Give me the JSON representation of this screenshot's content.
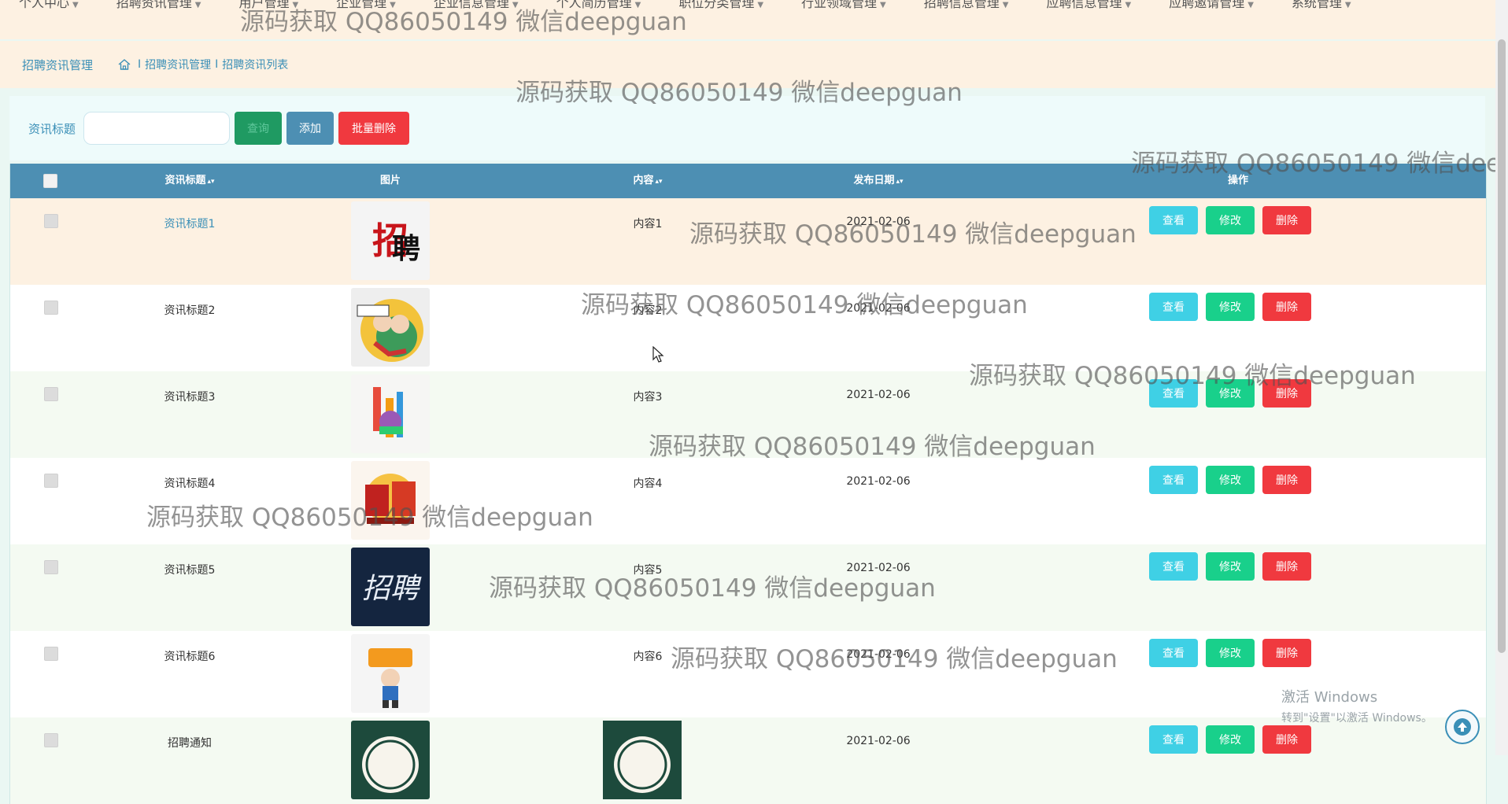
{
  "nav": {
    "items": [
      "个人中心",
      "招聘资讯管理",
      "用户管理",
      "企业管理",
      "企业信息管理",
      "个人简历管理",
      "职位分类管理",
      "行业领域管理",
      "招聘信息管理",
      "应聘信息管理",
      "应聘邀请管理",
      "系统管理"
    ]
  },
  "breadcrumb": {
    "title": "招聘资讯管理",
    "sep": "I",
    "items": [
      "招聘资讯管理",
      "招聘资讯列表"
    ]
  },
  "search": {
    "label": "资讯标题",
    "value": "",
    "placeholder": "",
    "search_label": "查询",
    "add_label": "添加",
    "batch_delete_label": "批量删除"
  },
  "table": {
    "columns": [
      "资讯标题",
      "图片",
      "内容",
      "发布日期",
      "操作"
    ],
    "sortable_marker": "▴▾",
    "rows": [
      {
        "title": "资讯标题1",
        "content": "内容1",
        "date": "2021-02-06",
        "image": "zhaopin-red-black"
      },
      {
        "title": "资讯标题2",
        "content": "内容2",
        "date": "2021-02-06",
        "image": "join-us-cartoon"
      },
      {
        "title": "资讯标题3",
        "content": "内容3",
        "date": "2021-02-06",
        "image": "colorful-zhao"
      },
      {
        "title": "资讯标题4",
        "content": "内容4",
        "date": "2021-02-06",
        "image": "red-gold-zhaopin"
      },
      {
        "title": "资讯标题5",
        "content": "内容5",
        "date": "2021-02-06",
        "image": "dark-blue-brush-zhaopin"
      },
      {
        "title": "资讯标题6",
        "content": "内容6",
        "date": "2021-02-06",
        "image": "orange-cartoon-zhaopin"
      },
      {
        "title": "招聘通知",
        "content": "",
        "date": "2021-02-06",
        "image": "green-circle-badge"
      }
    ],
    "ops": {
      "view": "查看",
      "edit": "修改",
      "delete": "删除"
    }
  },
  "watermark": "源码获取 QQ86050149 微信deepguan",
  "os_notice": {
    "title": "激活 Windows",
    "sub": "转到\"设置\"以激活 Windows。"
  },
  "colors": {
    "header_bg": "#fdf1e2",
    "table_header": "#4d8fb3",
    "accent": "#3a8fb7",
    "view": "#3fd0e5",
    "edit": "#19d08b",
    "delete": "#f0393f"
  }
}
